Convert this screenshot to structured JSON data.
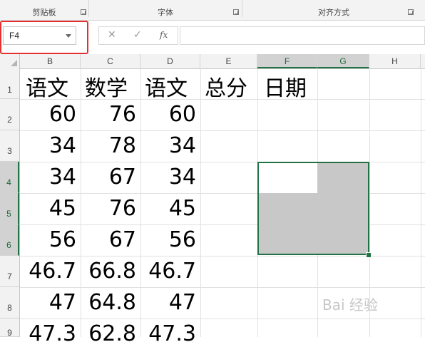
{
  "ribbon": {
    "groups": [
      "剪贴板",
      "字体",
      "对齐方式"
    ]
  },
  "formula_bar": {
    "name_box": "F4",
    "cancel_icon": "✕",
    "enter_icon": "✓",
    "fx_label": "fx",
    "value": ""
  },
  "columns": [
    "B",
    "C",
    "D",
    "E",
    "F",
    "G",
    "H"
  ],
  "selected_columns": [
    "F",
    "G"
  ],
  "rows": [
    "1",
    "2",
    "3",
    "4",
    "5",
    "6",
    "7",
    "8",
    "9"
  ],
  "selected_rows": [
    "4",
    "5",
    "6"
  ],
  "cells": {
    "r1": {
      "B": "语文",
      "C": "数学",
      "D": "语文",
      "E": "总分",
      "F": "日期"
    },
    "r2": {
      "B": "60",
      "C": "76",
      "D": "60"
    },
    "r3": {
      "B": "34",
      "C": "78",
      "D": "34"
    },
    "r4": {
      "B": "34",
      "C": "67",
      "D": "34"
    },
    "r5": {
      "B": "45",
      "C": "76",
      "D": "45"
    },
    "r6": {
      "B": "56",
      "C": "67",
      "D": "56"
    },
    "r7": {
      "B": "46.7",
      "C": "66.8",
      "D": "46.7"
    },
    "r8": {
      "B": "47",
      "C": "64.8",
      "D": "47"
    },
    "r9": {
      "B": "47.3",
      "C": "62.8",
      "D": "47.3"
    }
  },
  "selection": {
    "active_cell": "F4",
    "range": "F4:G6"
  },
  "colors": {
    "accent": "#217346",
    "highlight_box": "#e53030",
    "selection_fill": "#c8c8c8"
  },
  "watermark": "Bai 经验"
}
